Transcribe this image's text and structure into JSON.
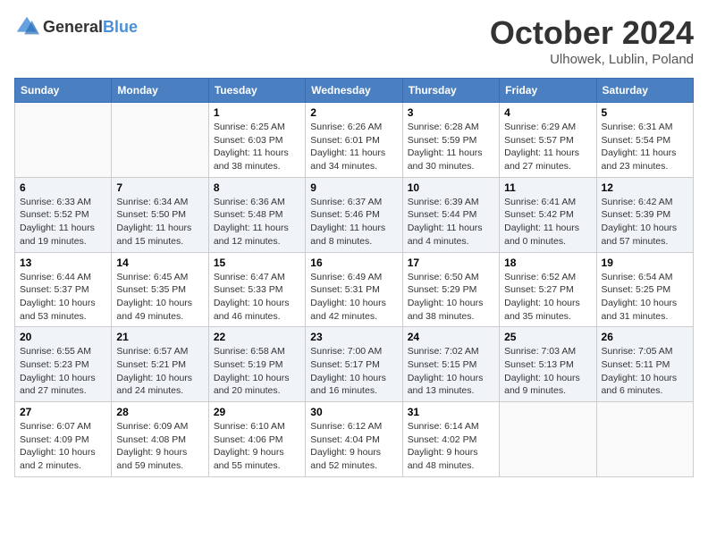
{
  "header": {
    "logo_general": "General",
    "logo_blue": "Blue",
    "title": "October 2024",
    "location": "Ulhowek, Lublin, Poland"
  },
  "weekdays": [
    "Sunday",
    "Monday",
    "Tuesday",
    "Wednesday",
    "Thursday",
    "Friday",
    "Saturday"
  ],
  "weeks": [
    [
      {
        "day": "",
        "info": ""
      },
      {
        "day": "",
        "info": ""
      },
      {
        "day": "1",
        "info": "Sunrise: 6:25 AM\nSunset: 6:03 PM\nDaylight: 11 hours and 38 minutes."
      },
      {
        "day": "2",
        "info": "Sunrise: 6:26 AM\nSunset: 6:01 PM\nDaylight: 11 hours and 34 minutes."
      },
      {
        "day": "3",
        "info": "Sunrise: 6:28 AM\nSunset: 5:59 PM\nDaylight: 11 hours and 30 minutes."
      },
      {
        "day": "4",
        "info": "Sunrise: 6:29 AM\nSunset: 5:57 PM\nDaylight: 11 hours and 27 minutes."
      },
      {
        "day": "5",
        "info": "Sunrise: 6:31 AM\nSunset: 5:54 PM\nDaylight: 11 hours and 23 minutes."
      }
    ],
    [
      {
        "day": "6",
        "info": "Sunrise: 6:33 AM\nSunset: 5:52 PM\nDaylight: 11 hours and 19 minutes."
      },
      {
        "day": "7",
        "info": "Sunrise: 6:34 AM\nSunset: 5:50 PM\nDaylight: 11 hours and 15 minutes."
      },
      {
        "day": "8",
        "info": "Sunrise: 6:36 AM\nSunset: 5:48 PM\nDaylight: 11 hours and 12 minutes."
      },
      {
        "day": "9",
        "info": "Sunrise: 6:37 AM\nSunset: 5:46 PM\nDaylight: 11 hours and 8 minutes."
      },
      {
        "day": "10",
        "info": "Sunrise: 6:39 AM\nSunset: 5:44 PM\nDaylight: 11 hours and 4 minutes."
      },
      {
        "day": "11",
        "info": "Sunrise: 6:41 AM\nSunset: 5:42 PM\nDaylight: 11 hours and 0 minutes."
      },
      {
        "day": "12",
        "info": "Sunrise: 6:42 AM\nSunset: 5:39 PM\nDaylight: 10 hours and 57 minutes."
      }
    ],
    [
      {
        "day": "13",
        "info": "Sunrise: 6:44 AM\nSunset: 5:37 PM\nDaylight: 10 hours and 53 minutes."
      },
      {
        "day": "14",
        "info": "Sunrise: 6:45 AM\nSunset: 5:35 PM\nDaylight: 10 hours and 49 minutes."
      },
      {
        "day": "15",
        "info": "Sunrise: 6:47 AM\nSunset: 5:33 PM\nDaylight: 10 hours and 46 minutes."
      },
      {
        "day": "16",
        "info": "Sunrise: 6:49 AM\nSunset: 5:31 PM\nDaylight: 10 hours and 42 minutes."
      },
      {
        "day": "17",
        "info": "Sunrise: 6:50 AM\nSunset: 5:29 PM\nDaylight: 10 hours and 38 minutes."
      },
      {
        "day": "18",
        "info": "Sunrise: 6:52 AM\nSunset: 5:27 PM\nDaylight: 10 hours and 35 minutes."
      },
      {
        "day": "19",
        "info": "Sunrise: 6:54 AM\nSunset: 5:25 PM\nDaylight: 10 hours and 31 minutes."
      }
    ],
    [
      {
        "day": "20",
        "info": "Sunrise: 6:55 AM\nSunset: 5:23 PM\nDaylight: 10 hours and 27 minutes."
      },
      {
        "day": "21",
        "info": "Sunrise: 6:57 AM\nSunset: 5:21 PM\nDaylight: 10 hours and 24 minutes."
      },
      {
        "day": "22",
        "info": "Sunrise: 6:58 AM\nSunset: 5:19 PM\nDaylight: 10 hours and 20 minutes."
      },
      {
        "day": "23",
        "info": "Sunrise: 7:00 AM\nSunset: 5:17 PM\nDaylight: 10 hours and 16 minutes."
      },
      {
        "day": "24",
        "info": "Sunrise: 7:02 AM\nSunset: 5:15 PM\nDaylight: 10 hours and 13 minutes."
      },
      {
        "day": "25",
        "info": "Sunrise: 7:03 AM\nSunset: 5:13 PM\nDaylight: 10 hours and 9 minutes."
      },
      {
        "day": "26",
        "info": "Sunrise: 7:05 AM\nSunset: 5:11 PM\nDaylight: 10 hours and 6 minutes."
      }
    ],
    [
      {
        "day": "27",
        "info": "Sunrise: 6:07 AM\nSunset: 4:09 PM\nDaylight: 10 hours and 2 minutes."
      },
      {
        "day": "28",
        "info": "Sunrise: 6:09 AM\nSunset: 4:08 PM\nDaylight: 9 hours and 59 minutes."
      },
      {
        "day": "29",
        "info": "Sunrise: 6:10 AM\nSunset: 4:06 PM\nDaylight: 9 hours and 55 minutes."
      },
      {
        "day": "30",
        "info": "Sunrise: 6:12 AM\nSunset: 4:04 PM\nDaylight: 9 hours and 52 minutes."
      },
      {
        "day": "31",
        "info": "Sunrise: 6:14 AM\nSunset: 4:02 PM\nDaylight: 9 hours and 48 minutes."
      },
      {
        "day": "",
        "info": ""
      },
      {
        "day": "",
        "info": ""
      }
    ]
  ]
}
